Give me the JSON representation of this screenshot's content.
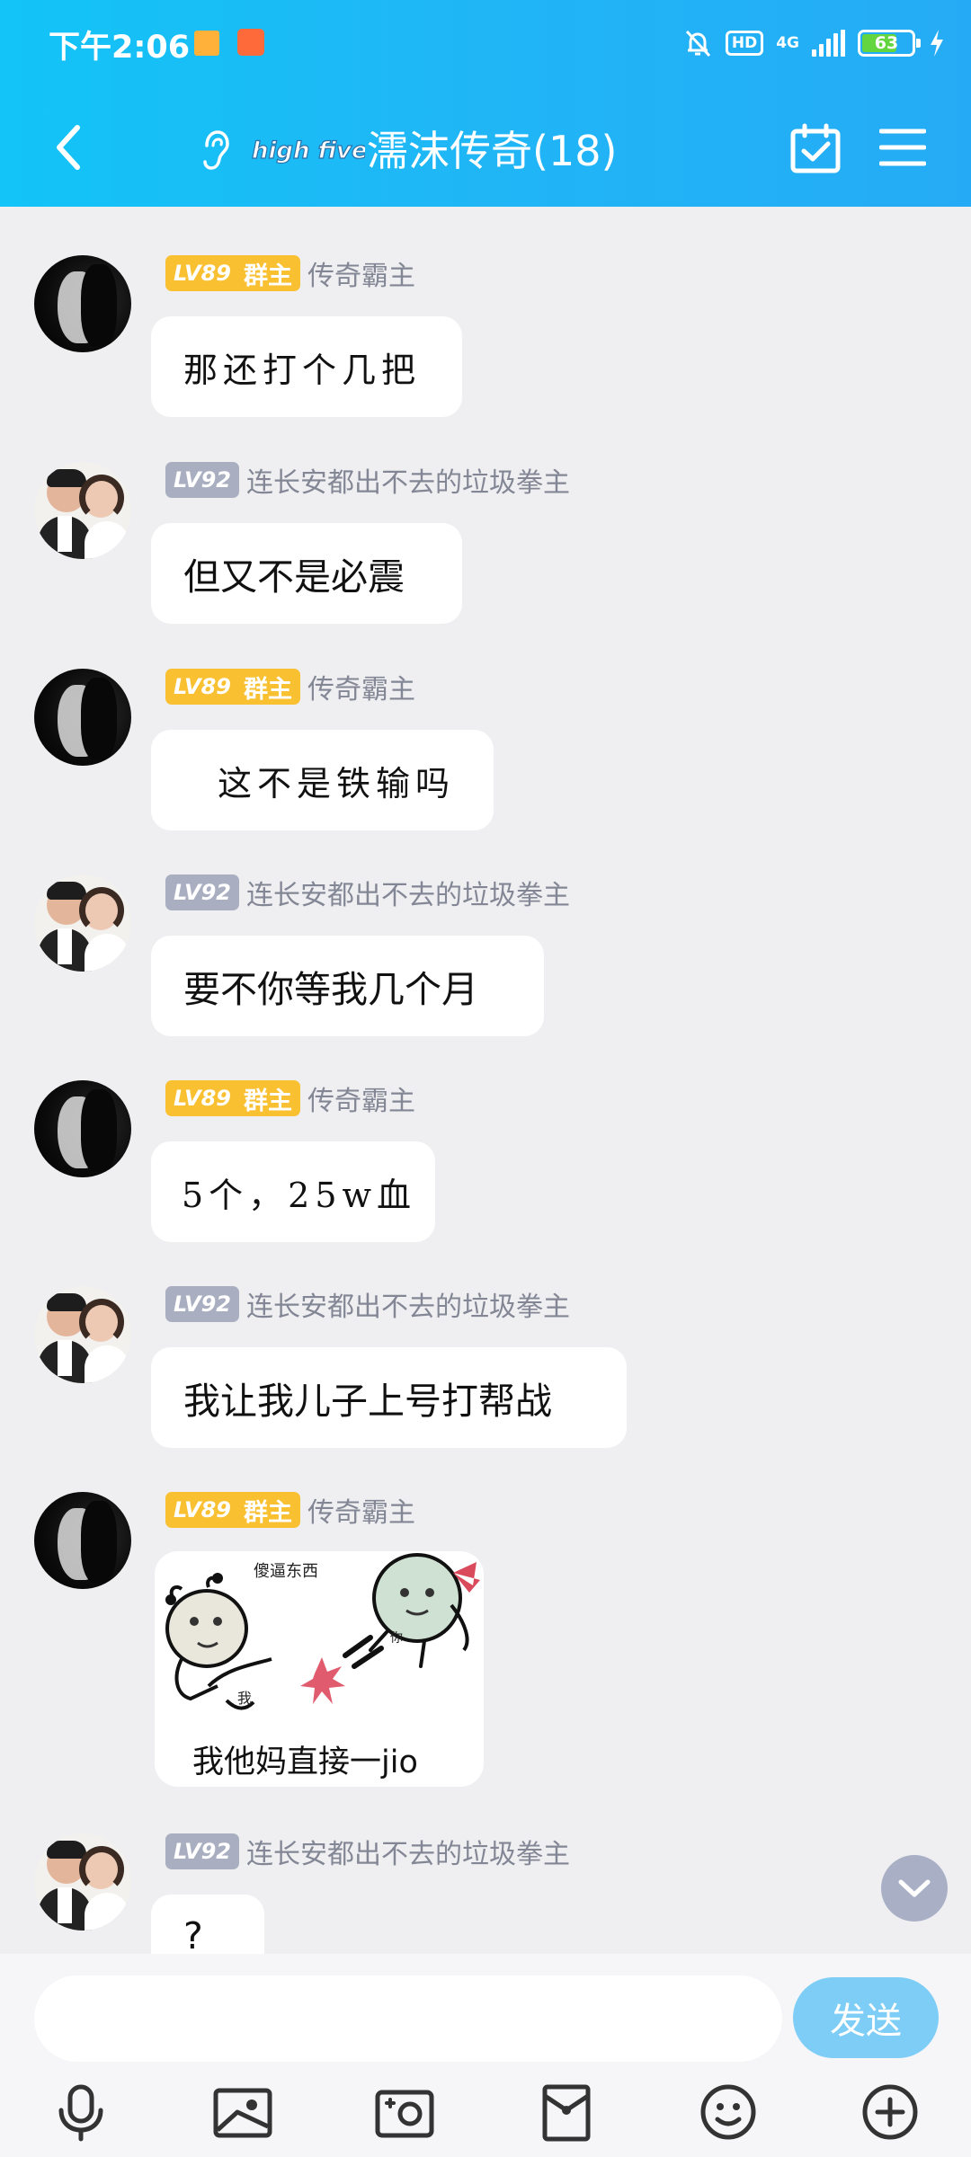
{
  "status_bar": {
    "time": "下午2:06",
    "hd": "HD",
    "network": "4G",
    "battery": "63",
    "icons": [
      "notification-square-icon",
      "shopping-bag-icon",
      "mute-bell-icon",
      "signal-icon",
      "charging-icon"
    ]
  },
  "header": {
    "title": "濡沫传奇(18)",
    "badge_text": "high five",
    "icons": [
      "back-arrow-icon",
      "ear-icon",
      "calendar-check-icon",
      "menu-icon"
    ]
  },
  "labels": {
    "lv89": "LV89",
    "lv92": "LV92",
    "owner": "群主"
  },
  "messages": [
    {
      "name": "传奇霸主",
      "text": "那还打个几把"
    },
    {
      "name": "连长安都出不去的垃圾拳主",
      "text": "但又不是必震"
    },
    {
      "name": "传奇霸主",
      "text": "这不是铁输吗"
    },
    {
      "name": "连长安都出不去的垃圾拳主",
      "text": "要不你等我几个月"
    },
    {
      "name": "传奇霸主",
      "text": "5个，25w血"
    },
    {
      "name": "连长安都出不去的垃圾拳主",
      "text": "我让我儿子上号打帮战"
    },
    {
      "name": "传奇霸主",
      "sticker_top": "傻逼东西",
      "sticker_me": "我",
      "sticker_you": "你",
      "sticker_caption": "我他妈直接一jio"
    },
    {
      "name": "连长安都出不去的垃圾拳主",
      "text": "?"
    }
  ],
  "input": {
    "placeholder": "",
    "send_label": "发送"
  },
  "toolbar": {
    "icons": [
      "microphone-icon",
      "image-icon",
      "camera-icon",
      "red-packet-icon",
      "emoji-icon",
      "plus-icon"
    ]
  },
  "colors": {
    "header_start": "#12c4f7",
    "header_end": "#25abf5",
    "owner_badge": "#f9c032",
    "level_badge": "#a9afc1",
    "send_button": "#7dcdf6",
    "background": "#efeff1"
  }
}
